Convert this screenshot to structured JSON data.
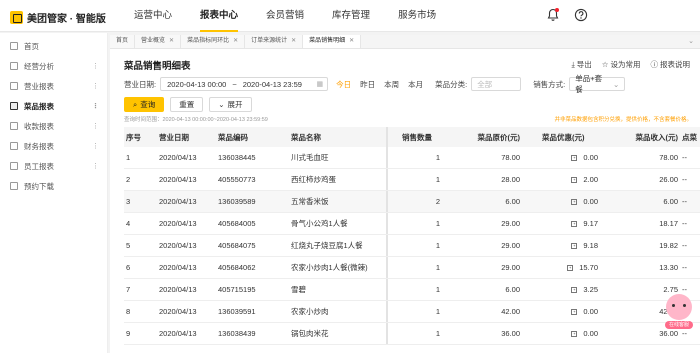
{
  "app": {
    "logo_text": "美团管家 · 智能版"
  },
  "topnav": [
    {
      "label": "运营中心",
      "active": false
    },
    {
      "label": "报表中心",
      "active": true
    },
    {
      "label": "会员营销",
      "active": false
    },
    {
      "label": "库存管理",
      "active": false
    },
    {
      "label": "服务市场",
      "active": false
    }
  ],
  "sidebar": {
    "items": [
      {
        "label": "首页",
        "active": false,
        "dots": false
      },
      {
        "label": "经营分析",
        "active": false,
        "dots": true
      },
      {
        "label": "营业报表",
        "active": false,
        "dots": true
      },
      {
        "label": "菜品报表",
        "active": true,
        "dots": true
      },
      {
        "label": "收款报表",
        "active": false,
        "dots": true
      },
      {
        "label": "财务报表",
        "active": false,
        "dots": true
      },
      {
        "label": "员工报表",
        "active": false,
        "dots": true
      },
      {
        "label": "预约下载",
        "active": false,
        "dots": false
      }
    ]
  },
  "tabs": [
    {
      "label": "首页",
      "closable": false,
      "active": false
    },
    {
      "label": "营业概览",
      "closable": true,
      "active": false
    },
    {
      "label": "菜品指标同环比",
      "closable": true,
      "active": false
    },
    {
      "label": "订单来源统计",
      "closable": true,
      "active": false
    },
    {
      "label": "菜品销售明细",
      "closable": true,
      "active": true
    }
  ],
  "page": {
    "title": "菜品销售明细表",
    "actions": {
      "export": "导出",
      "set_common": "设为常用",
      "report_help": "报表说明"
    }
  },
  "filters": {
    "date_label": "营业日期:",
    "date_start": "2020-04-13 00:00",
    "date_sep": "~",
    "date_end": "2020-04-13 23:59",
    "quick": {
      "today": "今日",
      "yesterday": "昨日",
      "this_week": "本周",
      "this_month": "本月"
    },
    "category_label": "菜品分类:",
    "category_placeholder": "全部",
    "sale_mode_label": "销售方式:",
    "sale_mode_value": "单品+套餐"
  },
  "buttons": {
    "query": "查询",
    "reset": "重置",
    "expand": "展开"
  },
  "update_time": "查询时间范围：2020-04-13 00:00:00~2020-04-13 23:59:59",
  "note": "并非菜品数据包含积分兑换，提供价格，不含套餐价格。",
  "table": {
    "headers": {
      "idx": "序号",
      "date": "营业日期",
      "code": "菜品编码",
      "name": "菜品名称",
      "qty": "销售数量",
      "price": "菜品原价(元)",
      "discount": "菜品优惠(元)",
      "revenue": "菜品收入(元)",
      "profit": "点菜"
    },
    "rows": [
      {
        "idx": "1",
        "date": "2020/04/13",
        "code": "136038445",
        "name": "川式毛血旺",
        "qty": "1",
        "price": "78.00",
        "discount": "0.00",
        "revenue": "78.00",
        "profit": "--"
      },
      {
        "idx": "2",
        "date": "2020/04/13",
        "code": "405550773",
        "name": "西红柿炒鸡蛋",
        "qty": "1",
        "price": "28.00",
        "discount": "2.00",
        "revenue": "26.00",
        "profit": "--"
      },
      {
        "idx": "3",
        "date": "2020/04/13",
        "code": "136039589",
        "name": "五常香米饭",
        "qty": "2",
        "price": "6.00",
        "discount": "0.00",
        "revenue": "6.00",
        "profit": "--"
      },
      {
        "idx": "4",
        "date": "2020/04/13",
        "code": "405684005",
        "name": "骨气小公鸡1人餐",
        "qty": "1",
        "price": "29.00",
        "discount": "9.17",
        "revenue": "18.17",
        "profit": "--"
      },
      {
        "idx": "5",
        "date": "2020/04/13",
        "code": "405684075",
        "name": "红烧丸子烧豆腐1人餐",
        "qty": "1",
        "price": "29.00",
        "discount": "9.18",
        "revenue": "19.82",
        "profit": "--"
      },
      {
        "idx": "6",
        "date": "2020/04/13",
        "code": "405684062",
        "name": "农家小炒肉1人餐(微辣)",
        "qty": "1",
        "price": "29.00",
        "discount": "15.70",
        "revenue": "13.30",
        "profit": "--"
      },
      {
        "idx": "7",
        "date": "2020/04/13",
        "code": "405715195",
        "name": "雪碧",
        "qty": "1",
        "price": "6.00",
        "discount": "3.25",
        "revenue": "2.75",
        "profit": "--"
      },
      {
        "idx": "8",
        "date": "2020/04/13",
        "code": "136039591",
        "name": "农家小炒肉",
        "qty": "1",
        "price": "42.00",
        "discount": "0.00",
        "revenue": "42.00",
        "profit": "--"
      },
      {
        "idx": "9",
        "date": "2020/04/13",
        "code": "136038439",
        "name": "锅包肉米花",
        "qty": "1",
        "price": "36.00",
        "discount": "0.00",
        "revenue": "36.00",
        "profit": "--"
      }
    ]
  },
  "assistant": {
    "label": "在线客服"
  },
  "colors": {
    "accent": "#ffc300",
    "orange": "#ff9f00"
  }
}
